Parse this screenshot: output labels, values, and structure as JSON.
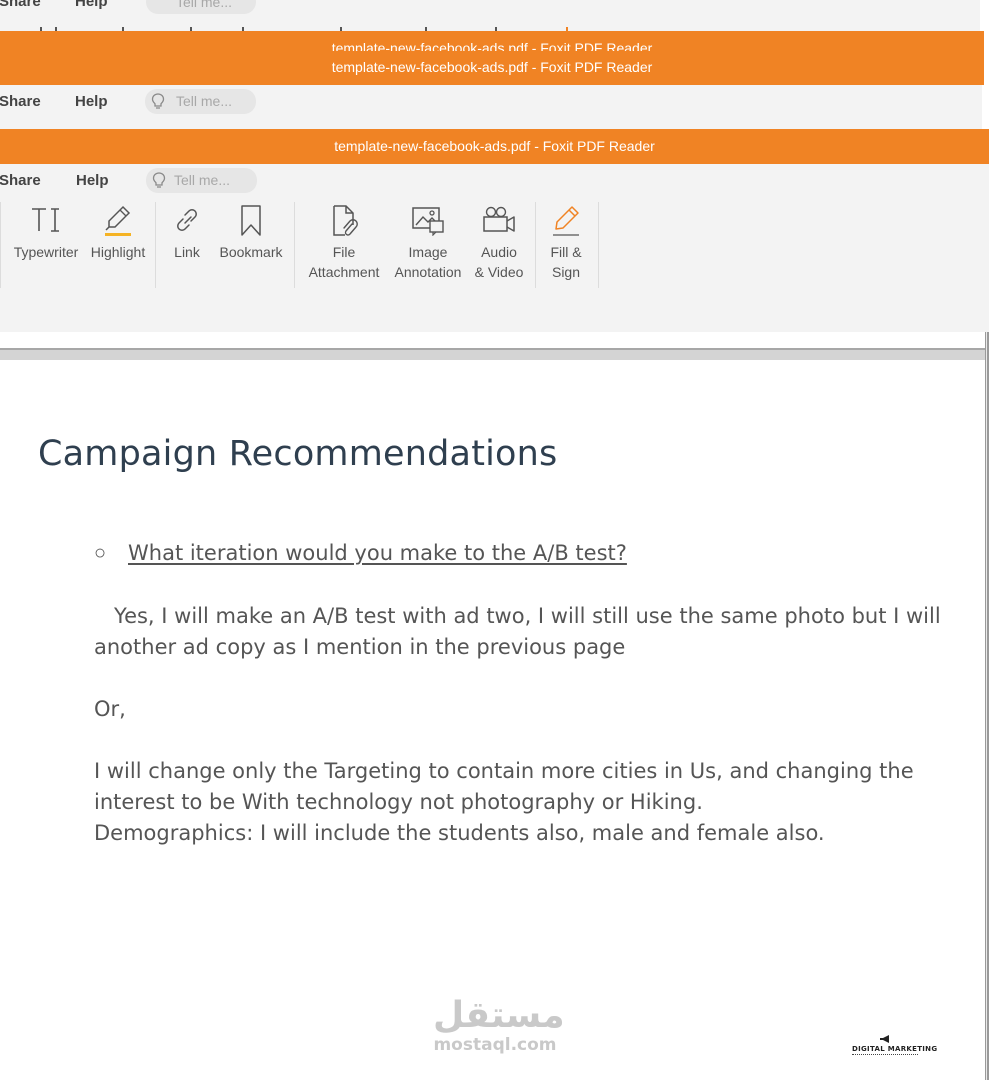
{
  "window": {
    "title": "template-new-facebook-ads.pdf - Foxit PDF Reader"
  },
  "menu": {
    "share": "Share",
    "help": "Help",
    "tell_me_placeholder": "Tell me..."
  },
  "ribbon": {
    "typewriter": "Typewriter",
    "highlight": "Highlight",
    "link": "Link",
    "bookmark": "Bookmark",
    "file_attachment_line1": "File",
    "file_attachment_line2": "Attachment",
    "image_annotation_line1": "Image",
    "image_annotation_line2": "Annotation",
    "audio_video_line1": "Audio",
    "audio_video_line2": "& Video",
    "fill_sign_line1": "Fill &",
    "fill_sign_line2": "Sign"
  },
  "document": {
    "title": "Campaign Recommendations",
    "bullet_symbol": "○",
    "question": "What iteration would you make to the A/B test?",
    "paragraph1_line1": "   Yes, I will make an A/B test with ad two, I will still use the same photo but I will",
    "paragraph1_line2": "another ad copy as I mention in the previous page",
    "or": "Or,",
    "paragraph2_line1": "I will change only the Targeting to contain more cities in Us, and changing the",
    "paragraph2_line2": "interest to be With technology not photography or Hiking.",
    "paragraph2_line3": "Demographics: I will include the students also, male and female also."
  },
  "watermark": {
    "arabic": "مستقل",
    "latin": "mostaql.com"
  },
  "brand": {
    "text": "DIGITAL MARKETING"
  },
  "colors": {
    "titlebar": "#f08324",
    "ribbon": "#f3f3f3",
    "heading": "#2f3f4f",
    "body_text": "#555555",
    "highlight_accent": "#f5b324",
    "fill_sign_accent": "#f08324"
  }
}
